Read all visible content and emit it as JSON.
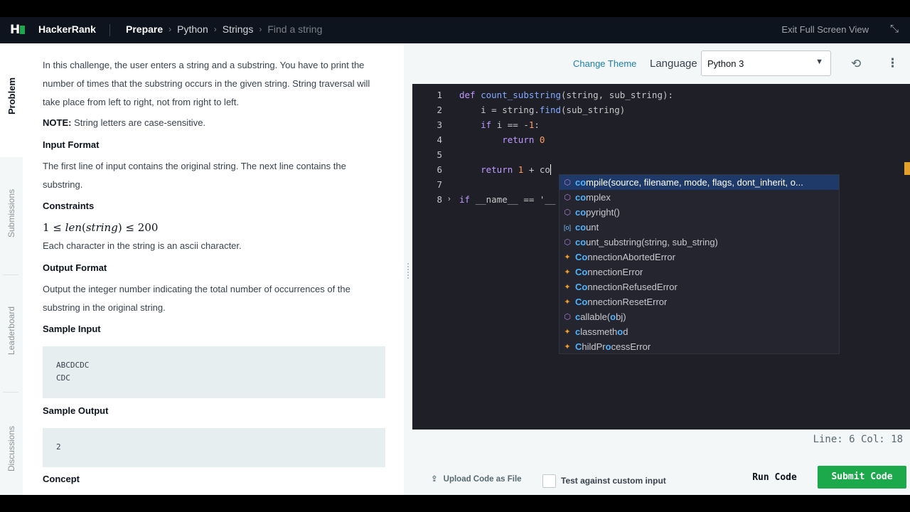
{
  "topbar": {
    "logo": "H",
    "brand": "HackerRank",
    "breadcrumbs": [
      "Prepare",
      "Python",
      "Strings",
      "Find a string"
    ],
    "exit_fullscreen": "Exit Full Screen View"
  },
  "tabs": [
    "Problem",
    "Submissions",
    "Leaderboard",
    "Discussions"
  ],
  "problem": {
    "intro": "In this challenge, the user enters a string and a substring. You have to print the number of times that the substring occurs in the given string. String traversal will take place from left to right, not from right to left.",
    "note_label": "NOTE:",
    "note_text": " String letters are case-sensitive.",
    "input_format_title": "Input Format",
    "input_format": "The first line of input contains the original string. The next line contains the substring.",
    "constraints_title": "Constraints",
    "constraint_left": "1 ≤ ",
    "constraint_func": "len",
    "constraint_arg": "string",
    "constraint_right": " ≤ 200",
    "constraint_note": "Each character in the string is an ascii character.",
    "output_format_title": "Output Format",
    "output_format": "Output the integer number indicating the total number of occurrences of the substring in the original string.",
    "sample_input_title": "Sample Input",
    "sample_input": "ABCDCDC\nCDC",
    "sample_output_title": "Sample Output",
    "sample_output": "2",
    "concept_title": "Concept"
  },
  "editor_header": {
    "change_theme": "Change Theme",
    "language_label": "Language",
    "language_value": "Python 3"
  },
  "editor": {
    "line_numbers": [
      "1",
      "2",
      "3",
      "4",
      "5",
      "6",
      "7",
      "8"
    ],
    "line1_kw": "def",
    "line1_fn": "count_substring",
    "line1_rest": "(string, sub_string):",
    "line2": "    i = string.",
    "line2_fn": "find",
    "line2_rest": "(sub_string)",
    "line3_kw": "if",
    "line3_rest": " i == -",
    "line3_num": "1",
    "line3_end": ":",
    "line4_kw": "return",
    "line4_num": "0",
    "line6_kw": "return",
    "line6_num": "1",
    "line6_rest": " + co",
    "line8_kw": "if",
    "line8_rest": " __name__ == '__"
  },
  "autocomplete": [
    {
      "icon": "method-icon",
      "hl": "co",
      "rest": "mpile(source, filename, mode, flags, dont_inherit, o...",
      "selected": true
    },
    {
      "icon": "method-icon",
      "hl": "co",
      "rest": "mplex"
    },
    {
      "icon": "method-icon",
      "hl": "co",
      "rest": "pyright()"
    },
    {
      "icon": "variable-icon",
      "hl": "co",
      "rest": "unt"
    },
    {
      "icon": "method-icon",
      "hl": "co",
      "rest": "unt_substring(string, sub_string)"
    },
    {
      "icon": "class-icon",
      "hl": "Co",
      "rest": "nnectionAbortedError"
    },
    {
      "icon": "class-icon",
      "hl": "Co",
      "rest": "nnectionError"
    },
    {
      "icon": "class-icon",
      "hl": "Co",
      "rest": "nnectionRefusedError"
    },
    {
      "icon": "class-icon",
      "hl": "Co",
      "rest": "nnectionResetError"
    },
    {
      "icon": "method-icon",
      "pre": "",
      "hl": "c",
      "rest": "allable(",
      "hl2": "o",
      "rest2": "bj)"
    },
    {
      "icon": "class-icon",
      "hl": "c",
      "rest": "lassmeth",
      "hl2": "o",
      "rest2": "d"
    },
    {
      "icon": "class-icon",
      "hl": "C",
      "rest": "hildPr",
      "hl2": "o",
      "rest2": "cessError"
    }
  ],
  "status": {
    "position": "Line: 6 Col: 18"
  },
  "actions": {
    "upload": "Upload Code as File",
    "custom_input": "Test against custom input",
    "run": "Run Code",
    "submit": "Submit Code"
  }
}
